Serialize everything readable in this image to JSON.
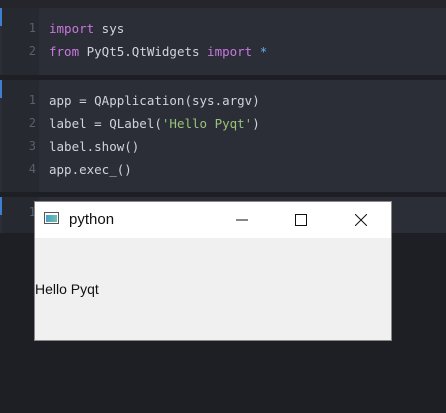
{
  "cells": [
    {
      "lines": [
        {
          "number": "1",
          "tokens": [
            {
              "t": "import",
              "c": "kw"
            },
            {
              "t": " sys",
              "c": ""
            }
          ]
        },
        {
          "number": "2",
          "tokens": [
            {
              "t": "from",
              "c": "kw"
            },
            {
              "t": " PyQt5.QtWidgets ",
              "c": ""
            },
            {
              "t": "import",
              "c": "kw"
            },
            {
              "t": " ",
              "c": ""
            },
            {
              "t": "*",
              "c": "star"
            }
          ]
        }
      ]
    },
    {
      "lines": [
        {
          "number": "1",
          "tokens": [
            {
              "t": "app = QApplication(sys.argv)",
              "c": ""
            }
          ]
        },
        {
          "number": "2",
          "tokens": [
            {
              "t": "label = QLabel(",
              "c": ""
            },
            {
              "t": "'Hello Pyqt'",
              "c": "str"
            },
            {
              "t": ")",
              "c": ""
            }
          ]
        },
        {
          "number": "3",
          "tokens": [
            {
              "t": "label.show()",
              "c": ""
            }
          ]
        },
        {
          "number": "4",
          "tokens": [
            {
              "t": "app.exec_()",
              "c": ""
            }
          ]
        }
      ]
    },
    {
      "lines": [
        {
          "number": "1",
          "tokens": []
        }
      ]
    }
  ],
  "window": {
    "title": "python",
    "label_text": "Hello Pyqt",
    "controls": [
      "minimize-icon",
      "maximize-icon",
      "close-icon"
    ]
  },
  "colors": {
    "keyword": "#c678dd",
    "string": "#98c379",
    "operator": "#61afef",
    "cell_marker": "#3f7fd0"
  }
}
